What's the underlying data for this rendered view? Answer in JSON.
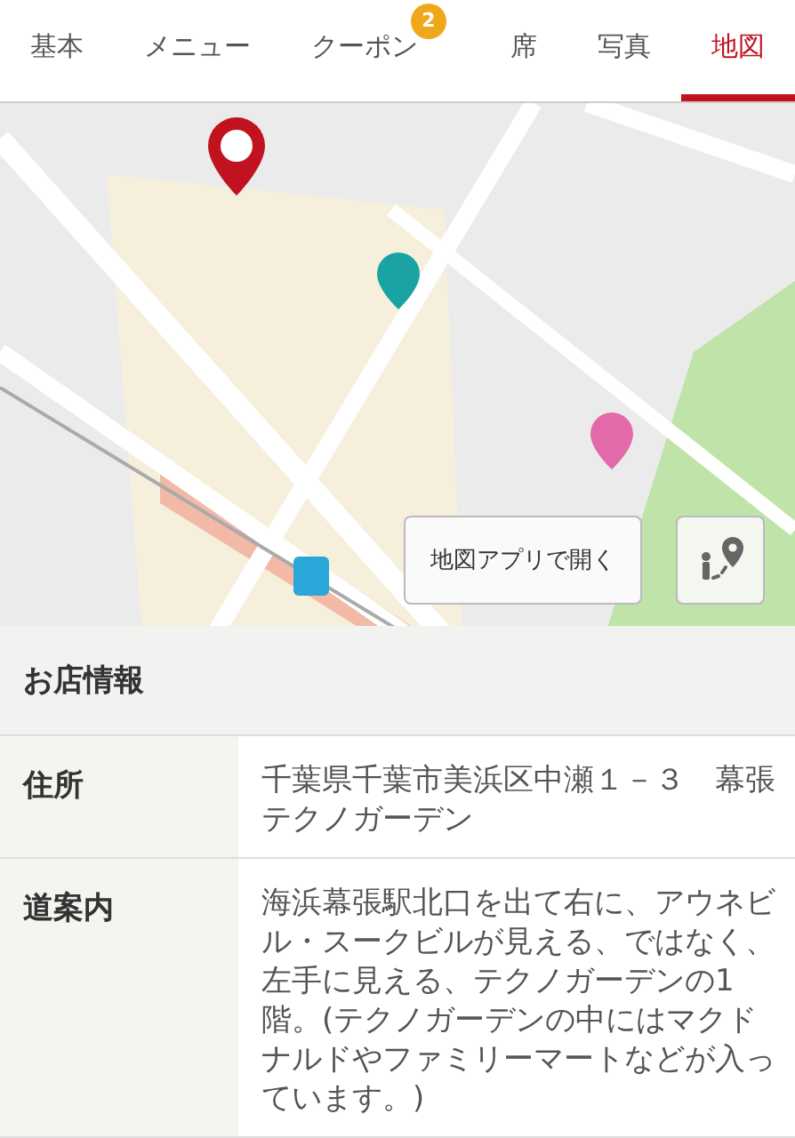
{
  "tabs": [
    {
      "label": "基本",
      "selected": false
    },
    {
      "label": "メニュー",
      "selected": false
    },
    {
      "label": "クーポン",
      "selected": false,
      "badge": "2"
    },
    {
      "label": "席",
      "selected": false
    },
    {
      "label": "写真",
      "selected": false
    },
    {
      "label": "地図",
      "selected": true
    }
  ],
  "map": {
    "kind": "picture",
    "open_button": "地図アプリで開く"
  },
  "section_title": "お店情報",
  "info_rows": [
    {
      "label": "住所",
      "value": "千葉県千葉市美浜区中瀬１－３　幕張テクノガーデン"
    },
    {
      "label": "道案内",
      "value": "海浜幕張駅北口を出て右に、アウネビル・スークビルが見える、ではなく、左手に見える、テクノガーデンの1階。(テクノガーデンの中にはマクドナルドやファミリーマートなどが入っています。)"
    }
  ]
}
